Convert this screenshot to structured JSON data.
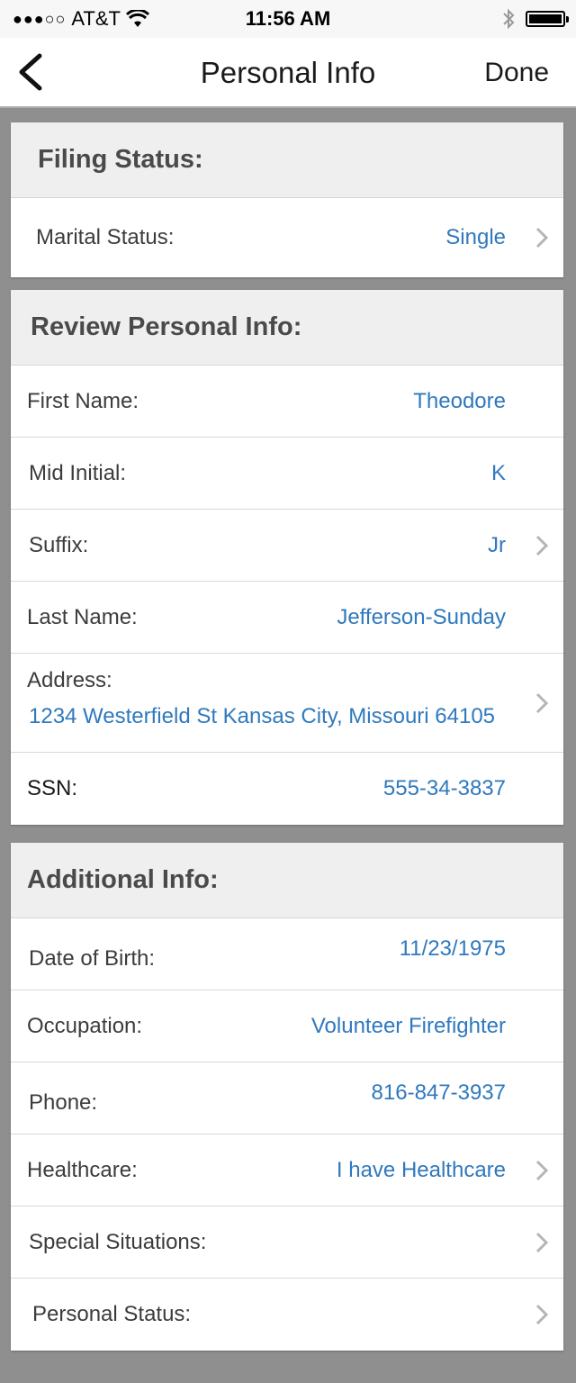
{
  "status_bar": {
    "signal": "●●●○○",
    "carrier": "AT&T",
    "time": "11:56 AM"
  },
  "nav": {
    "title": "Personal Info",
    "done_label": "Done"
  },
  "filing": {
    "header": "Filing Status:",
    "marital_label": "Marital Status:",
    "marital_value": "Single"
  },
  "review": {
    "header": "Review Personal Info:",
    "first_name_label": "First Name:",
    "first_name_value": "Theodore",
    "mid_initial_label": "Mid Initial:",
    "mid_initial_value": "K",
    "suffix_label": "Suffix:",
    "suffix_value": "Jr",
    "last_name_label": "Last Name:",
    "last_name_value": "Jefferson-Sunday",
    "address_label": "Address:",
    "address_value": "1234 Westerfield St Kansas City, Missouri 64105",
    "ssn_label": "SSN:",
    "ssn_value": "555-34-3837"
  },
  "additional": {
    "header": "Additional Info:",
    "dob_label": "Date of Birth:",
    "dob_value": "11/23/1975",
    "occupation_label": "Occupation:",
    "occupation_value": "Volunteer Firefighter",
    "phone_label": "Phone:",
    "phone_value": "816-847-3937",
    "healthcare_label": "Healthcare:",
    "healthcare_value": "I have Healthcare",
    "special_label": "Special Situations:",
    "personal_status_label": "Personal Status:"
  },
  "colors": {
    "value_blue": "#2f79bd",
    "header_bg": "#efefef",
    "page_bg": "#8f8f8f"
  },
  "icons": [
    "back-chevron-icon",
    "wifi-icon",
    "bluetooth-icon",
    "battery-icon",
    "chevron-right-icon"
  ]
}
